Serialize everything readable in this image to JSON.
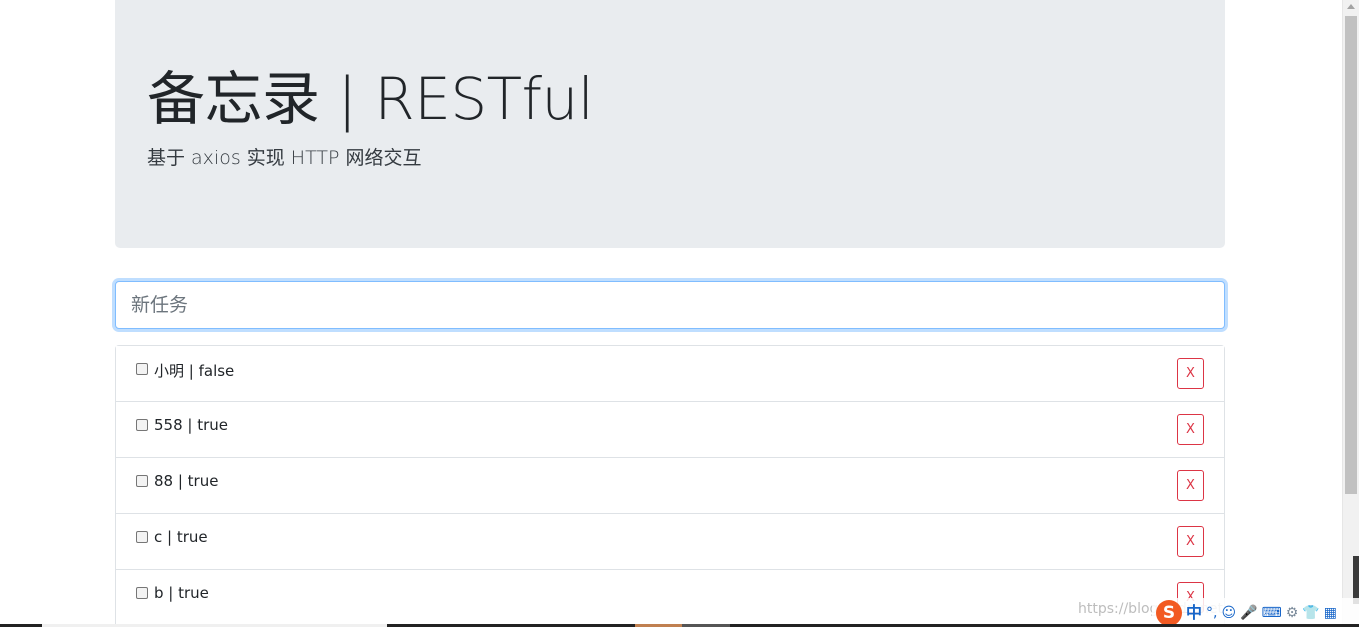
{
  "header": {
    "title": "备忘录 | RESTful",
    "subtitle": "基于 axios 实现 HTTP 网络交互"
  },
  "new_task": {
    "placeholder": "新任务",
    "value": ""
  },
  "tasks": [
    {
      "label": "小明 | false",
      "checked": false,
      "delete_label": "X"
    },
    {
      "label": "558 | true",
      "checked": false,
      "delete_label": "X"
    },
    {
      "label": "88 | true",
      "checked": false,
      "delete_label": "X"
    },
    {
      "label": "c | true",
      "checked": false,
      "delete_label": "X"
    },
    {
      "label": "b | true",
      "checked": false,
      "delete_label": "X"
    }
  ],
  "ime_toolbar": {
    "logo": "S",
    "mode": "中",
    "icons": [
      "punctuation-icon",
      "emoji-icon",
      "microphone-icon",
      "keyboard-icon",
      "settings-icon",
      "skin-icon",
      "grid-icon"
    ]
  },
  "watermark": "https://blog.csdn.net",
  "colors": {
    "jumbotron_bg": "#e9ecef",
    "focus_border": "#80bdff",
    "danger": "#dc3545",
    "ime_logo": "#f25a22"
  }
}
